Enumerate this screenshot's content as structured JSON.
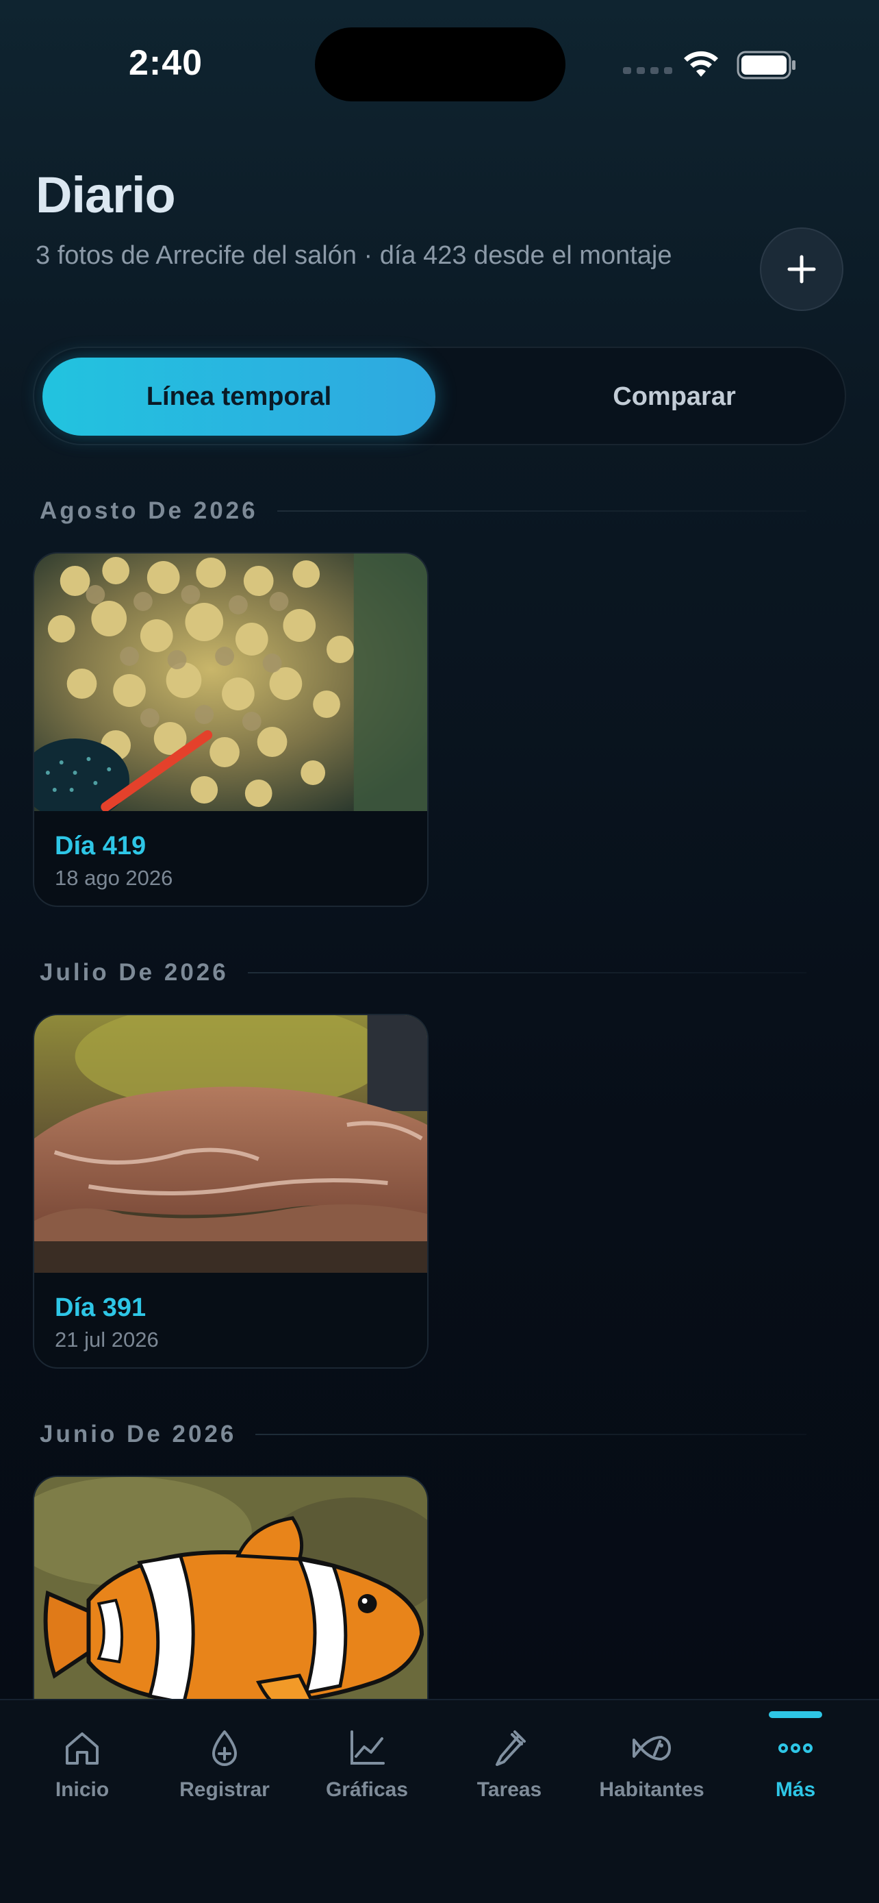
{
  "status_bar": {
    "time": "2:40"
  },
  "header": {
    "title": "Diario",
    "subtitle": "3 fotos de Arrecife del salón · día 423 desde el montaje"
  },
  "segmented": {
    "options": [
      "Línea temporal",
      "Comparar"
    ],
    "selected": "Línea temporal"
  },
  "timeline": [
    {
      "month": "Agosto De 2026",
      "entries": [
        {
          "day": "Día 419",
          "date": "18 ago 2026",
          "photo": "acropora-coral-photo"
        }
      ]
    },
    {
      "month": "Julio De 2026",
      "entries": [
        {
          "day": "Día 391",
          "date": "21 jul 2026",
          "photo": "plate-coral-photo"
        }
      ]
    },
    {
      "month": "Junio De 2026",
      "entries": [
        {
          "photo": "clownfish-photo"
        }
      ]
    }
  ],
  "tabbar": {
    "items": [
      {
        "label": "Inicio",
        "icon": "home-icon"
      },
      {
        "label": "Registrar",
        "icon": "drop-plus-icon"
      },
      {
        "label": "Gráficas",
        "icon": "chart-icon"
      },
      {
        "label": "Tareas",
        "icon": "pipette-icon"
      },
      {
        "label": "Habitantes",
        "icon": "fish-icon"
      },
      {
        "label": "Más",
        "icon": "more-icon"
      }
    ],
    "active": "Más"
  },
  "colors": {
    "accent": "#2ec6e6",
    "background": "#07101a"
  }
}
